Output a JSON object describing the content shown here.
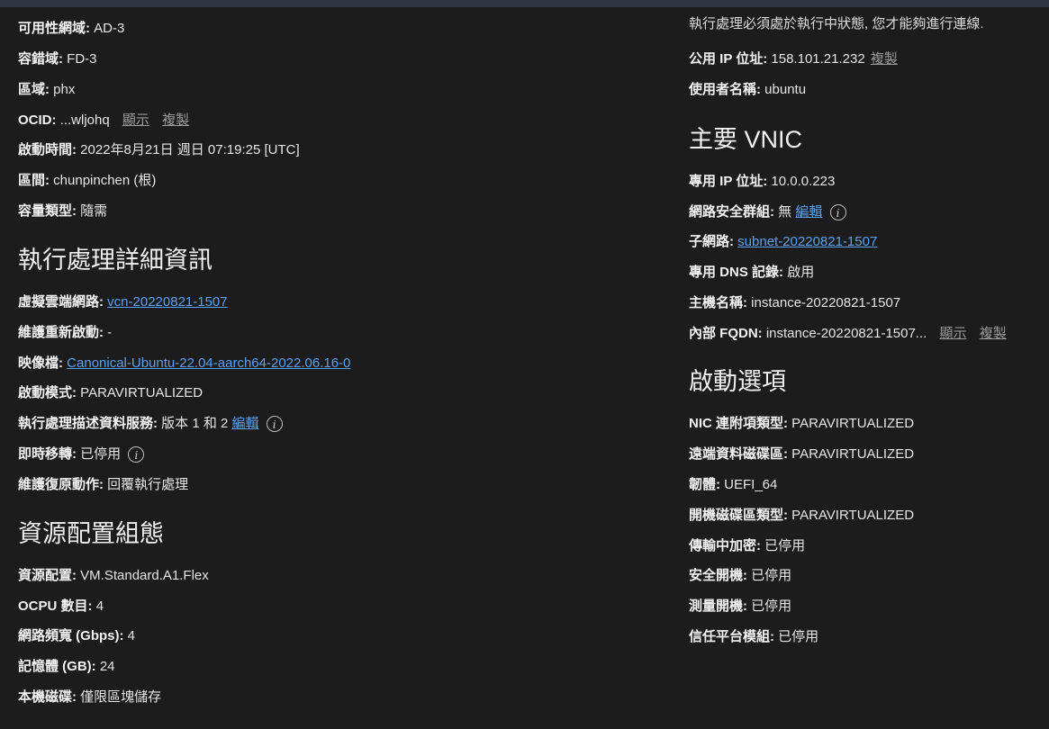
{
  "left": {
    "rows_top": [
      {
        "label": "可用性網域:",
        "value": "AD-3"
      },
      {
        "label": "容錯域:",
        "value": "FD-3"
      },
      {
        "label": "區域:",
        "value": "phx"
      }
    ],
    "ocid": {
      "label": "OCID:",
      "value": "...wljohq",
      "show": "顯示",
      "copy": "複製"
    },
    "rows_mid": [
      {
        "label": "啟動時間:",
        "value": "2022年8月21日 週日 07:19:25 [UTC]"
      },
      {
        "label": "區間:",
        "value": "chunpinchen (根)"
      },
      {
        "label": "容量類型:",
        "value": "隨需"
      }
    ],
    "section_details": {
      "title": "執行處理詳細資訊",
      "vcn": {
        "label": "虛擬雲端網路:",
        "value": "vcn-20220821-1507"
      },
      "maint_reboot": {
        "label": "維護重新啟動:",
        "value": "-"
      },
      "image": {
        "label": "映像檔:",
        "value": "Canonical-Ubuntu-22.04-aarch64-2022.06.16-0"
      },
      "launch_mode": {
        "label": "啟動模式:",
        "value": "PARAVIRTUALIZED"
      },
      "imds": {
        "label": "執行處理描述資料服務:",
        "value": "版本 1 和 2",
        "edit": "編輯"
      },
      "live_migration": {
        "label": "即時移轉:",
        "value": "已停用"
      },
      "maint_recovery": {
        "label": "維護復原動作:",
        "value": "回覆執行處理"
      }
    },
    "section_resource": {
      "title": "資源配置組態",
      "rows": [
        {
          "label": "資源配置:",
          "value": "VM.Standard.A1.Flex"
        },
        {
          "label": "OCPU 數目:",
          "value": "4"
        },
        {
          "label": "網路頻寬 (Gbps):",
          "value": "4"
        },
        {
          "label": "記憶體 (GB):",
          "value": "24"
        },
        {
          "label": "本機磁碟:",
          "value": "僅限區塊儲存"
        }
      ]
    }
  },
  "right": {
    "note": "執行處理必須處於執行中狀態, 您才能夠進行連線.",
    "public_ip": {
      "label": "公用 IP 位址:",
      "value": "158.101.21.232",
      "copy": "複製"
    },
    "username": {
      "label": "使用者名稱:",
      "value": "ubuntu"
    },
    "section_vnic": {
      "title": "主要 VNIC",
      "private_ip": {
        "label": "專用 IP 位址:",
        "value": "10.0.0.223"
      },
      "nsg": {
        "label": "網路安全群組:",
        "value": "無",
        "edit": "編輯"
      },
      "subnet": {
        "label": "子網路:",
        "value": "subnet-20220821-1507"
      },
      "dns": {
        "label": "專用 DNS 記錄:",
        "value": "啟用"
      },
      "hostname": {
        "label": "主機名稱:",
        "value": "instance-20220821-1507"
      },
      "fqdn": {
        "label": "內部 FQDN:",
        "value": "instance-20220821-1507...",
        "show": "顯示",
        "copy": "複製"
      }
    },
    "section_launch": {
      "title": "啟動選項",
      "rows": [
        {
          "label": "NIC 連附項類型:",
          "value": "PARAVIRTUALIZED"
        },
        {
          "label": "遠端資料磁碟區:",
          "value": "PARAVIRTUALIZED"
        },
        {
          "label": "韌體:",
          "value": "UEFI_64"
        },
        {
          "label": "開機磁碟區類型:",
          "value": "PARAVIRTUALIZED"
        },
        {
          "label": "傳輸中加密:",
          "value": "已停用"
        },
        {
          "label": "安全開機:",
          "value": "已停用"
        },
        {
          "label": "測量開機:",
          "value": "已停用"
        },
        {
          "label": "信任平台模組:",
          "value": "已停用"
        }
      ]
    }
  },
  "icons": {
    "info_glyph": "i"
  }
}
